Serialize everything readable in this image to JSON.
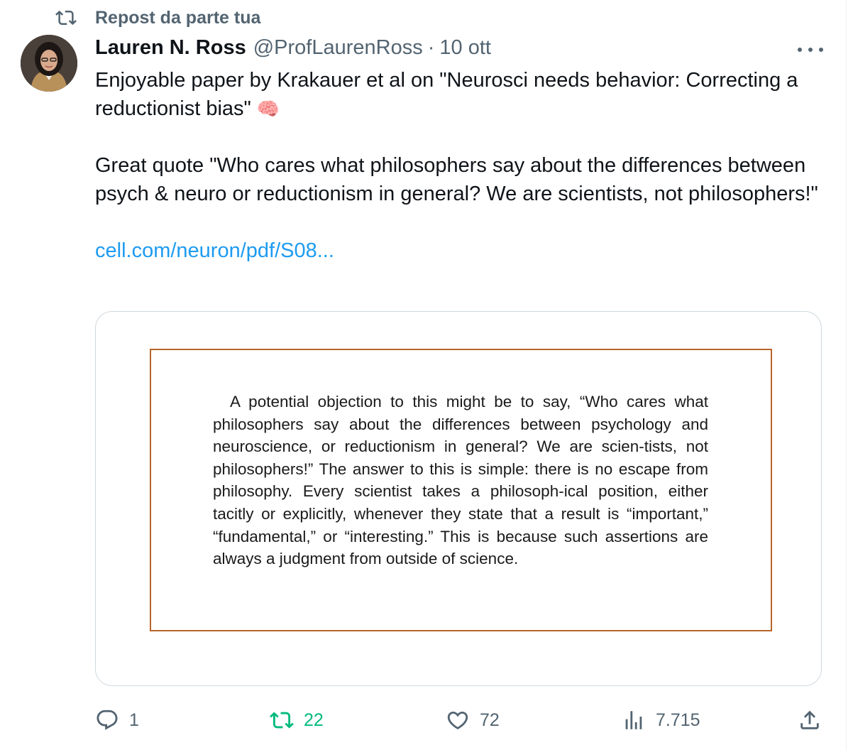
{
  "repost_label": "Repost da parte tua",
  "tweet": {
    "author_name": "Lauren N. Ross",
    "handle": "@ProfLaurenRoss",
    "separator": "·",
    "timestamp": "10 ott",
    "text_line1": "Enjoyable paper by Krakauer et al on \"Neurosci needs behavior: Correcting a reductionist bias\"",
    "brain_emoji": "🧠",
    "text_quote": "Great quote \"Who cares what philosophers say about the differences between psych & neuro or reductionism in general? We are scientists, not philosophers!\"",
    "link_text": "cell.com/neuron/pdf/S08..."
  },
  "image_card": {
    "excerpt": "A potential objection to this might be to say, “Who cares what philosophers say about the differences between psychology and neuroscience, or reductionism in general? We are scien-tists, not philosophers!” The answer to this is simple: there is no escape from philosophy. Every scientist takes a philosoph-ical position, either tacitly or explicitly, whenever they state that a result is “important,” “fundamental,” or “interesting.” This is because such assertions are always a judgment from outside of science.",
    "border_color": "#b8652a"
  },
  "actions": {
    "replies": "1",
    "reposts": "22",
    "likes": "72",
    "views": "7.715"
  },
  "colors": {
    "secondary_text": "#536471",
    "link": "#1d9bf0",
    "repost_active": "#00ba7c"
  }
}
